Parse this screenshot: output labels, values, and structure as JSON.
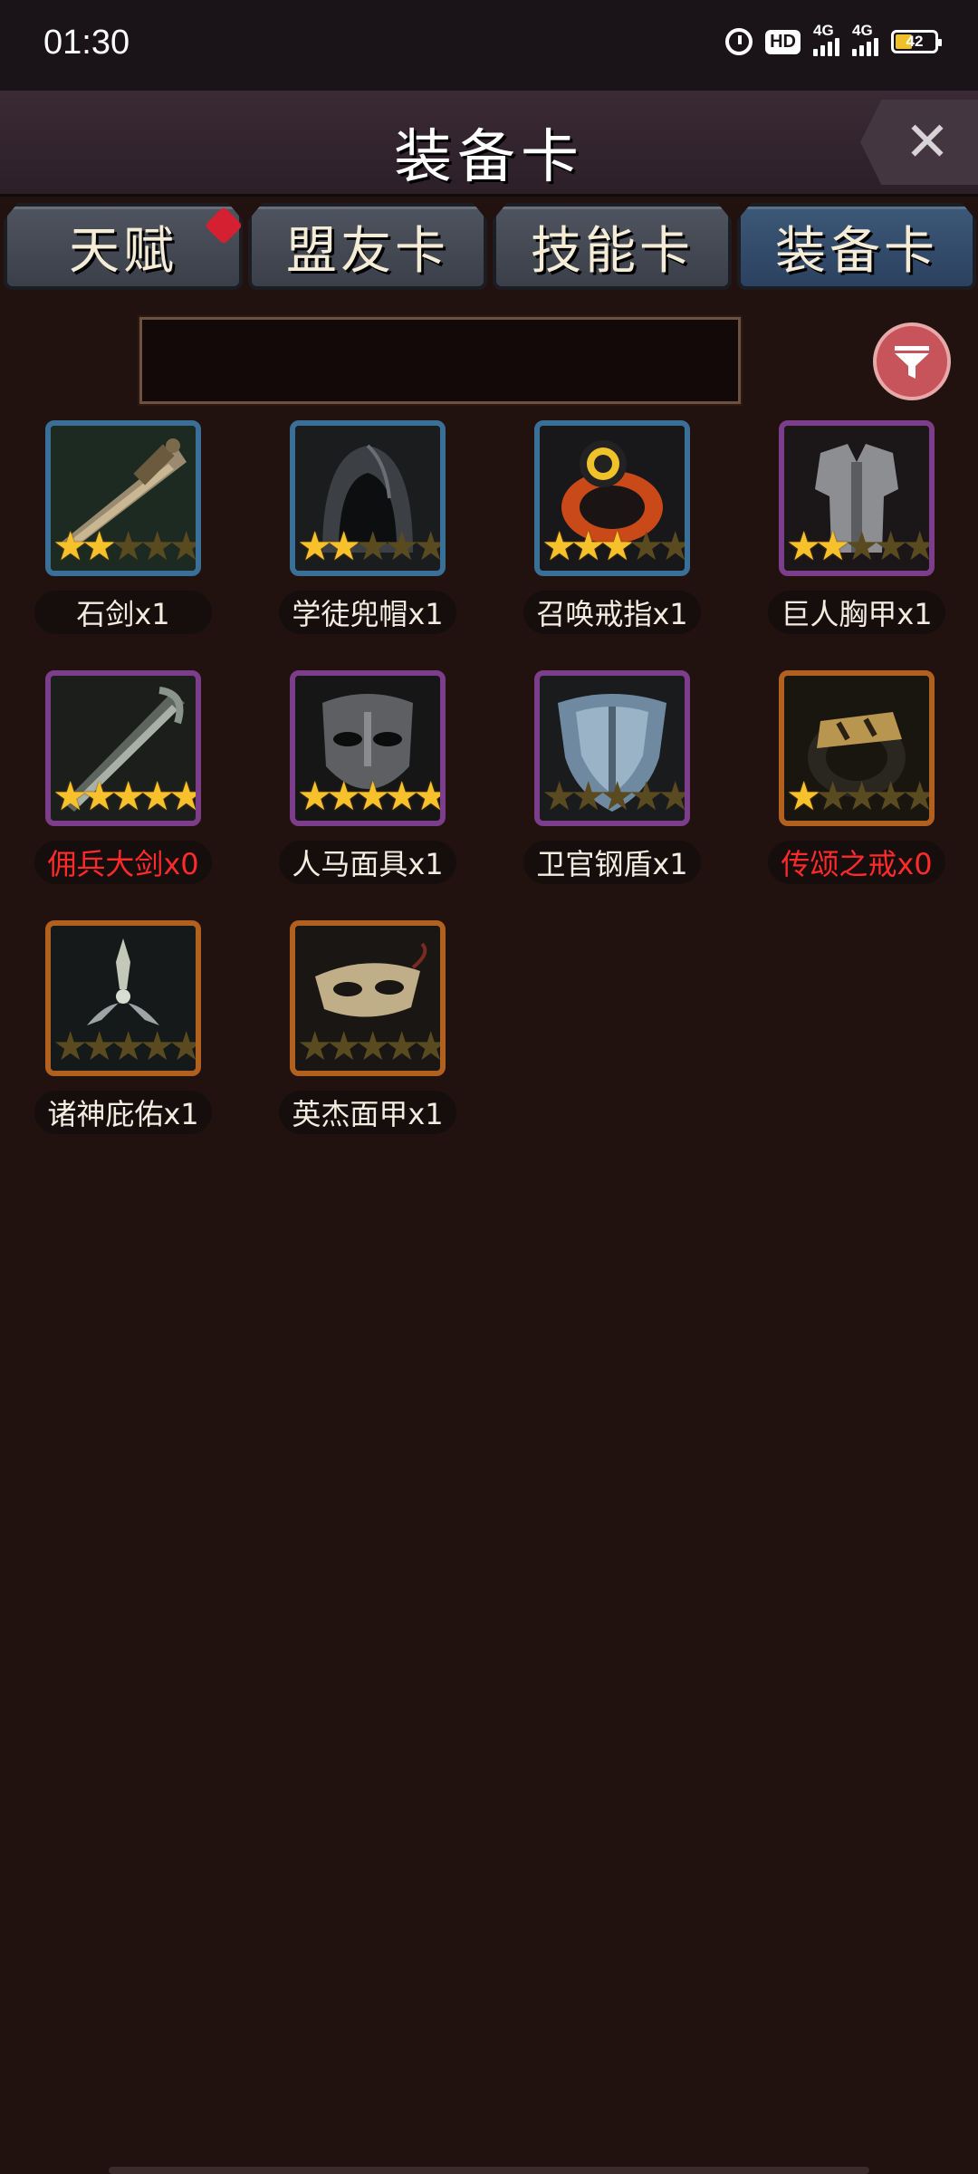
{
  "status_bar": {
    "time": "01:30",
    "hd": "HD",
    "net1": "4G",
    "net2": "4G",
    "battery": "42"
  },
  "header": {
    "title": "装备卡",
    "close_icon": "close-icon"
  },
  "tabs": [
    {
      "label": "天赋",
      "active": false,
      "badge": true
    },
    {
      "label": "盟友卡",
      "active": false,
      "badge": false
    },
    {
      "label": "技能卡",
      "active": false,
      "badge": false
    },
    {
      "label": "装备卡",
      "active": true,
      "badge": false
    }
  ],
  "search": {
    "value": "",
    "placeholder": ""
  },
  "filter": {
    "icon": "filter-icon",
    "color": "#c8545b"
  },
  "cards": [
    {
      "label": "石剑x1",
      "icon": "stone-sword-icon",
      "stars": 2,
      "frame": "blue",
      "count_zero": false
    },
    {
      "label": "学徒兜帽x1",
      "icon": "apprentice-hood-icon",
      "stars": 2,
      "frame": "blue",
      "count_zero": false
    },
    {
      "label": "召唤戒指x1",
      "icon": "summon-ring-icon",
      "stars": 3,
      "frame": "blue",
      "count_zero": false
    },
    {
      "label": "巨人胸甲x1",
      "icon": "giant-chestplate-icon",
      "stars": 2,
      "frame": "purple",
      "count_zero": false
    },
    {
      "label": "佣兵大剑x0",
      "icon": "mercenary-greatsword-icon",
      "stars": 5,
      "frame": "purple",
      "count_zero": true
    },
    {
      "label": "人马面具x1",
      "icon": "centaur-mask-icon",
      "stars": 5,
      "frame": "purple",
      "count_zero": false
    },
    {
      "label": "卫官钢盾x1",
      "icon": "guard-steel-shield-icon",
      "stars": 0,
      "frame": "purple",
      "count_zero": false
    },
    {
      "label": "传颂之戒x0",
      "icon": "legend-ring-icon",
      "stars": 1,
      "frame": "orange",
      "count_zero": true
    },
    {
      "label": "诸神庇佑x1",
      "icon": "divine-blessing-icon",
      "stars": 0,
      "frame": "orange",
      "count_zero": false
    },
    {
      "label": "英杰面甲x1",
      "icon": "hero-visor-icon",
      "stars": 0,
      "frame": "orange",
      "count_zero": false
    }
  ],
  "colors": {
    "background": "#22120f",
    "zero_count_text": "#ff2a2a",
    "star_on": "#f6c12b",
    "star_off": "#5a4a20"
  }
}
